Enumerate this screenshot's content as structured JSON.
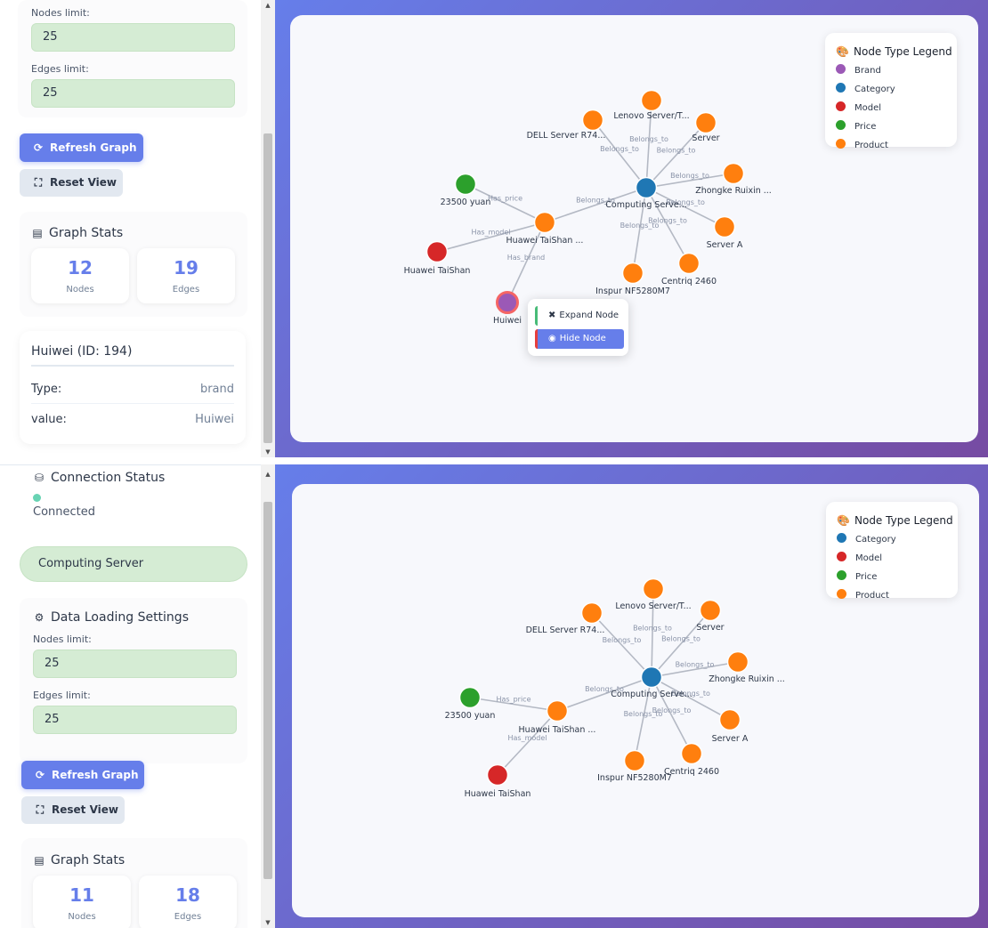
{
  "colors": {
    "brand": "#9b59b6",
    "category": "#1f77b4",
    "model": "#d62728",
    "price": "#2ca02c",
    "product": "#ff7f0e",
    "accent": "#667eea",
    "connected": "#68d3b3"
  },
  "top": {
    "sidebar": {
      "nodes_limit_label": "Nodes limit:",
      "nodes_limit_value": "25",
      "edges_limit_label": "Edges limit:",
      "edges_limit_value": "25",
      "refresh_label": "Refresh Graph",
      "reset_label": "Reset View",
      "stats_title": "Graph Stats",
      "nodes_count": "12",
      "nodes_label": "Nodes",
      "edges_count": "19",
      "edges_label": "Edges",
      "details": {
        "title": "Huiwei (ID: 194)",
        "type_label": "Type:",
        "type_value": "brand",
        "value_label": "value:",
        "value_value": "Huiwei"
      }
    },
    "legend": {
      "title": "Node Type Legend",
      "items": [
        {
          "label": "Brand",
          "type": "brand"
        },
        {
          "label": "Category",
          "type": "category"
        },
        {
          "label": "Model",
          "type": "model"
        },
        {
          "label": "Price",
          "type": "price"
        },
        {
          "label": "Product",
          "type": "product"
        }
      ]
    },
    "context_menu": {
      "expand_label": "Expand Node",
      "hide_label": "Hide Node"
    },
    "graph": {
      "nodes": [
        {
          "id": "computing",
          "label": "Computing Serve...",
          "type": "category"
        },
        {
          "id": "lenovo",
          "label": "Lenovo Server/T...",
          "type": "product"
        },
        {
          "id": "dell",
          "label": "DELL Server R74...",
          "type": "product"
        },
        {
          "id": "server",
          "label": "Server",
          "type": "product"
        },
        {
          "id": "zhongke",
          "label": "Zhongke Ruixin ...",
          "type": "product"
        },
        {
          "id": "servera",
          "label": "Server A",
          "type": "product"
        },
        {
          "id": "centriq",
          "label": "Centriq 2460",
          "type": "product"
        },
        {
          "id": "inspur",
          "label": "Inspur NF5280M7",
          "type": "product"
        },
        {
          "id": "huaweits",
          "label": "Huawei TaiShan ...",
          "type": "product"
        },
        {
          "id": "price",
          "label": "23500 yuan",
          "type": "price"
        },
        {
          "id": "model",
          "label": "Huawei TaiShan",
          "type": "model"
        },
        {
          "id": "huiwei",
          "label": "Huiwei",
          "type": "brand"
        }
      ],
      "edges": [
        {
          "s": "lenovo",
          "t": "computing",
          "label": "Belongs_to"
        },
        {
          "s": "dell",
          "t": "computing",
          "label": "Belongs_to"
        },
        {
          "s": "server",
          "t": "computing",
          "label": "Belongs_to"
        },
        {
          "s": "zhongke",
          "t": "computing",
          "label": "Belongs_to"
        },
        {
          "s": "servera",
          "t": "computing",
          "label": "Belongs_to"
        },
        {
          "s": "centriq",
          "t": "computing",
          "label": "Belongs_to"
        },
        {
          "s": "inspur",
          "t": "computing",
          "label": "Belongs_to"
        },
        {
          "s": "huaweits",
          "t": "computing",
          "label": "Belongs_to"
        },
        {
          "s": "huaweits",
          "t": "price",
          "label": "Has_price"
        },
        {
          "s": "huaweits",
          "t": "model",
          "label": "Has_model"
        },
        {
          "s": "huiwei",
          "t": "huaweits",
          "label": "Has_brand"
        }
      ]
    }
  },
  "bottom": {
    "sidebar": {
      "connection_title": "Connection Status",
      "connection_state": "Connected",
      "selected_category": "Computing Server",
      "loading_title": "Data Loading Settings",
      "nodes_limit_label": "Nodes limit:",
      "nodes_limit_value": "25",
      "edges_limit_label": "Edges limit:",
      "edges_limit_value": "25",
      "refresh_label": "Refresh Graph",
      "reset_label": "Reset View",
      "stats_title": "Graph Stats",
      "nodes_count": "11",
      "nodes_label": "Nodes",
      "edges_count": "18",
      "edges_label": "Edges"
    },
    "legend": {
      "title": "Node Type Legend",
      "items": [
        {
          "label": "Category",
          "type": "category"
        },
        {
          "label": "Model",
          "type": "model"
        },
        {
          "label": "Price",
          "type": "price"
        },
        {
          "label": "Product",
          "type": "product"
        }
      ]
    },
    "graph": {
      "nodes": [
        {
          "id": "computing",
          "label": "Computing Serve...",
          "type": "category"
        },
        {
          "id": "lenovo",
          "label": "Lenovo Server/T...",
          "type": "product"
        },
        {
          "id": "dell",
          "label": "DELL Server R74...",
          "type": "product"
        },
        {
          "id": "server",
          "label": "Server",
          "type": "product"
        },
        {
          "id": "zhongke",
          "label": "Zhongke Ruixin ...",
          "type": "product"
        },
        {
          "id": "servera",
          "label": "Server A",
          "type": "product"
        },
        {
          "id": "centriq",
          "label": "Centriq 2460",
          "type": "product"
        },
        {
          "id": "inspur",
          "label": "Inspur NF5280M7",
          "type": "product"
        },
        {
          "id": "huaweits",
          "label": "Huawei TaiShan ...",
          "type": "product"
        },
        {
          "id": "price",
          "label": "23500 yuan",
          "type": "price"
        },
        {
          "id": "model",
          "label": "Huawei TaiShan",
          "type": "model"
        }
      ],
      "edges": [
        {
          "s": "lenovo",
          "t": "computing",
          "label": "Belongs_to"
        },
        {
          "s": "dell",
          "t": "computing",
          "label": "Belongs_to"
        },
        {
          "s": "server",
          "t": "computing",
          "label": "Belongs_to"
        },
        {
          "s": "zhongke",
          "t": "computing",
          "label": "Belongs_to"
        },
        {
          "s": "servera",
          "t": "computing",
          "label": "Belongs_to"
        },
        {
          "s": "centriq",
          "t": "computing",
          "label": "Belongs_to"
        },
        {
          "s": "inspur",
          "t": "computing",
          "label": "Belongs_to"
        },
        {
          "s": "huaweits",
          "t": "computing",
          "label": "Belongs_to"
        },
        {
          "s": "huaweits",
          "t": "price",
          "label": "Has_price"
        },
        {
          "s": "huaweits",
          "t": "model",
          "label": "Has_model"
        }
      ]
    }
  }
}
